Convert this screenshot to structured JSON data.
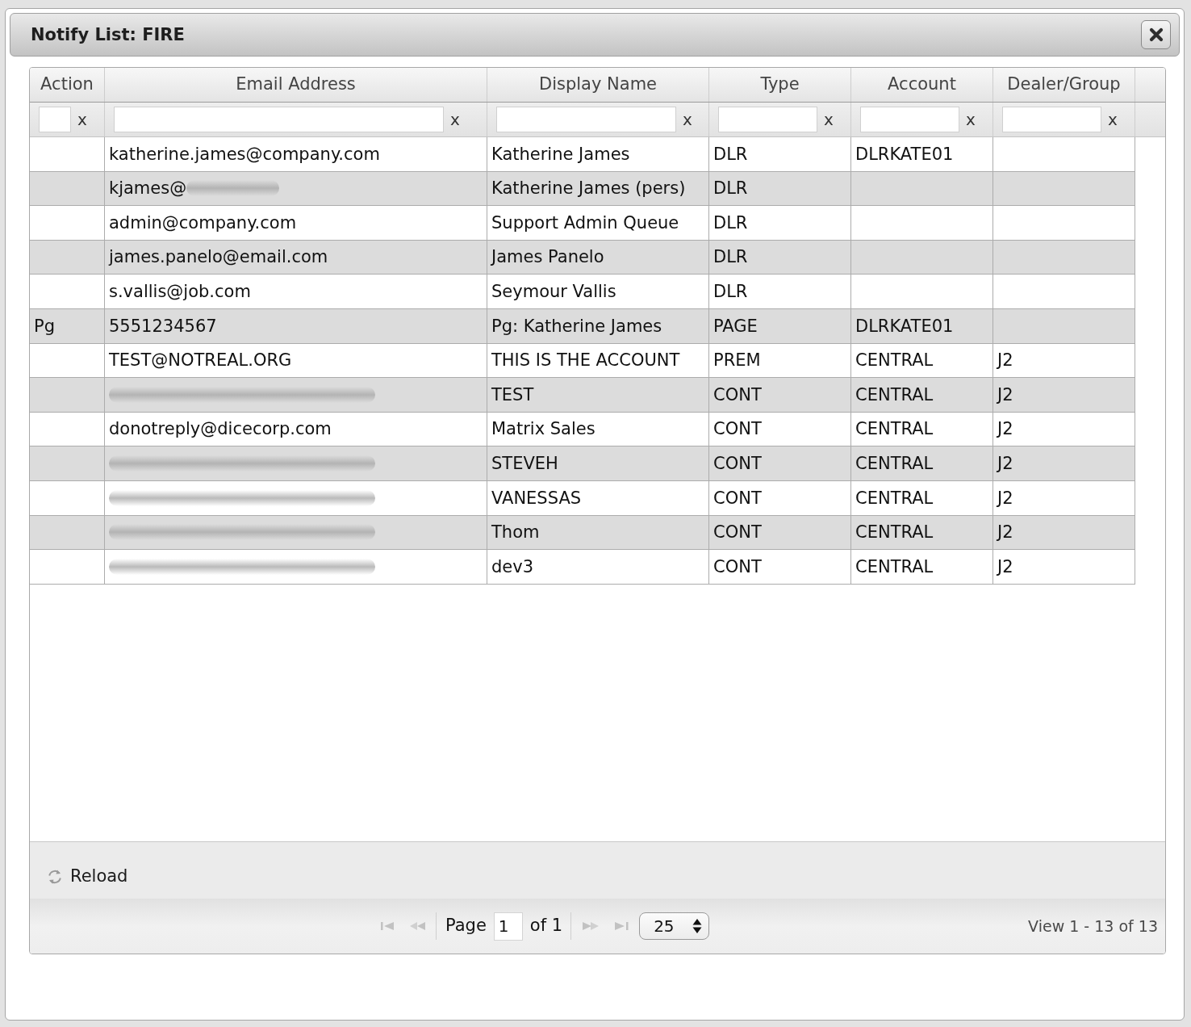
{
  "dialog": {
    "title": "Notify List: FIRE"
  },
  "grid": {
    "columns": [
      {
        "label": "Action",
        "filter_clear": "x"
      },
      {
        "label": "Email Address",
        "filter_clear": "x"
      },
      {
        "label": "Display Name",
        "filter_clear": "x"
      },
      {
        "label": "Type",
        "filter_clear": "x"
      },
      {
        "label": "Account",
        "filter_clear": "x"
      },
      {
        "label": "Dealer/Group",
        "filter_clear": "x"
      }
    ],
    "rows": [
      {
        "email": "katherine.james@company.com",
        "email_blurred": false,
        "display_name": "Katherine James",
        "type": "DLR",
        "account": "DLRKATE01"
      },
      {
        "email": "kjames@",
        "email_blurred": true,
        "display_name": "Katherine James (pers)",
        "type": "DLR"
      },
      {
        "email": "admin@company.com",
        "email_blurred": false,
        "display_name": "Support Admin Queue",
        "type": "DLR"
      },
      {
        "email": "james.panelo@email.com",
        "email_blurred": false,
        "display_name": "James Panelo",
        "type": "DLR"
      },
      {
        "email": "s.vallis@job.com",
        "email_blurred": false,
        "display_name": "Seymour Vallis",
        "type": "DLR"
      },
      {
        "action": "Pg",
        "email": "5551234567",
        "email_blurred": false,
        "display_name": "Pg: Katherine James",
        "type": "PAGE",
        "account": "DLRKATE01"
      },
      {
        "email": "TEST@NOTREAL.ORG",
        "email_blurred": false,
        "display_name": "THIS IS THE ACCOUNT",
        "type": "PREM",
        "account": "CENTRAL",
        "dealer_group": "J2"
      },
      {
        "email_blurred": true,
        "display_name": "TEST",
        "type": "CONT",
        "account": "CENTRAL",
        "dealer_group": "J2"
      },
      {
        "email": "donotreply@dicecorp.com",
        "email_blurred": false,
        "display_name": "Matrix Sales",
        "type": "CONT",
        "account": "CENTRAL",
        "dealer_group": "J2"
      },
      {
        "email_blurred": true,
        "display_name": "STEVEH",
        "type": "CONT",
        "account": "CENTRAL",
        "dealer_group": "J2"
      },
      {
        "email_blurred": true,
        "display_name": "VANESSAS",
        "type": "CONT",
        "account": "CENTRAL",
        "dealer_group": "J2"
      },
      {
        "email_blurred": true,
        "display_name": "Thom",
        "type": "CONT",
        "account": "CENTRAL",
        "dealer_group": "J2"
      },
      {
        "email_blurred": true,
        "display_name": "dev3",
        "type": "CONT",
        "account": "CENTRAL",
        "dealer_group": "J2"
      }
    ]
  },
  "footer": {
    "reload": "Reload",
    "pager": {
      "nav_buttons": [
        {
          "kind": "first",
          "disabled": true
        },
        {
          "kind": "previous",
          "disabled": true
        },
        {
          "kind": "next",
          "disabled": true
        },
        {
          "kind": "last",
          "disabled": true
        }
      ],
      "page_label": "Page",
      "page": "1",
      "page_total": "of 1",
      "page_size": "25",
      "summary": "View 1 - 13 of 13"
    }
  }
}
